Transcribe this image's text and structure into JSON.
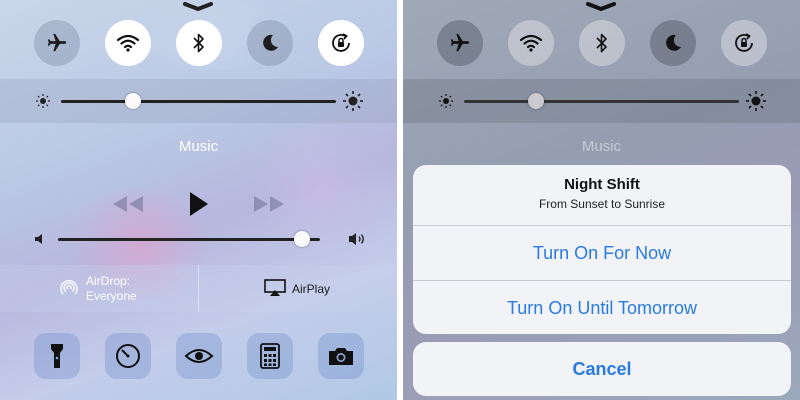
{
  "left_panel": {
    "toggles": [
      {
        "icon": "airplane-icon",
        "state": "off"
      },
      {
        "icon": "wifi-icon",
        "state": "on"
      },
      {
        "icon": "bluetooth-icon",
        "state": "on"
      },
      {
        "icon": "moon-icon",
        "state": "off"
      },
      {
        "icon": "rotation-lock-icon",
        "state": "on"
      }
    ],
    "brightness_level": 0.26,
    "music": {
      "title": "Music",
      "volume_level": 0.93
    },
    "airdrop": {
      "line1": "AirDrop:",
      "line2": "Everyone"
    },
    "airplay": {
      "label": "AirPlay"
    },
    "tools": [
      "flashlight-icon",
      "timer-icon",
      "night-shift-icon",
      "calculator-icon",
      "camera-icon"
    ]
  },
  "right_panel": {
    "brightness_level": 0.26,
    "music": {
      "title": "Music"
    },
    "night_shift_sheet": {
      "title": "Night Shift",
      "subtitle": "From Sunset to Sunrise",
      "option1": "Turn On For Now",
      "option2": "Turn On Until Tomorrow",
      "cancel": "Cancel"
    }
  },
  "colors": {
    "accent": "#2a7be0"
  }
}
